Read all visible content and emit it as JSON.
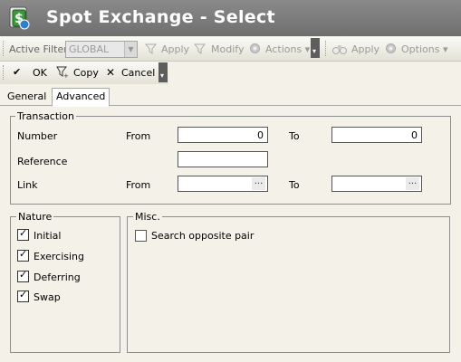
{
  "window": {
    "title": "Spot Exchange - Select"
  },
  "toolbar1": {
    "active_filter_label": "Active Filter",
    "filter_value": "GLOBAL",
    "apply_label": "Apply",
    "modify_label": "Modify",
    "actions_label": "Actions",
    "apply2_label": "Apply",
    "options_label": "Options"
  },
  "toolbar2": {
    "ok_label": "OK",
    "copy_label": "Copy",
    "cancel_label": "Cancel"
  },
  "tabs": [
    {
      "label": "General",
      "active": false
    },
    {
      "label": "Advanced",
      "active": true
    }
  ],
  "transaction": {
    "legend": "Transaction",
    "number_label": "Number",
    "from_label": "From",
    "to_label": "To",
    "number_from": "0",
    "number_to": "0",
    "reference_label": "Reference",
    "reference_value": "",
    "link_label": "Link",
    "link_from_label": "From",
    "link_to_label": "To",
    "link_from": "",
    "link_to": "",
    "ellipsis": "..."
  },
  "nature": {
    "legend": "Nature",
    "items": [
      {
        "label": "Initial",
        "checked": true
      },
      {
        "label": "Exercising",
        "checked": true
      },
      {
        "label": "Deferring",
        "checked": true
      },
      {
        "label": "Swap",
        "checked": true
      }
    ]
  },
  "misc": {
    "legend": "Misc.",
    "search_opposite_label": "Search opposite pair",
    "search_opposite_checked": false
  },
  "colors": {
    "titlebar": "#7a7a7a",
    "icon_green": "#2e8b2e",
    "background": "#f3f1e8"
  }
}
